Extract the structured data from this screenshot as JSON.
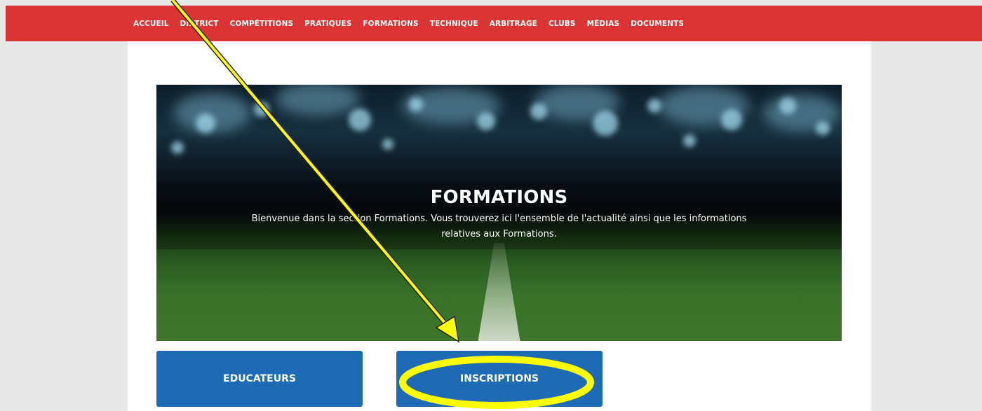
{
  "nav": {
    "items": [
      {
        "label": "ACCUEIL"
      },
      {
        "label": "DISTRICT"
      },
      {
        "label": "COMPÉTITIONS"
      },
      {
        "label": "PRATIQUES"
      },
      {
        "label": "FORMATIONS"
      },
      {
        "label": "TECHNIQUE"
      },
      {
        "label": "ARBITRAGE"
      },
      {
        "label": "CLUBS"
      },
      {
        "label": "MÉDIAS"
      },
      {
        "label": "DOCUMENTS"
      }
    ]
  },
  "hero": {
    "title": "FORMATIONS",
    "description": "Bienvenue dans la section Formations. Vous trouverez ici l'ensemble de l'actualité ainsi que les informations relatives aux Formations."
  },
  "buttons": {
    "educateurs": "EDUCATEURS",
    "inscriptions": "INSCRIPTIONS"
  },
  "colors": {
    "nav_bg": "#db3434",
    "button_bg": "#1f6ab5",
    "annotation": "#ffff00"
  }
}
